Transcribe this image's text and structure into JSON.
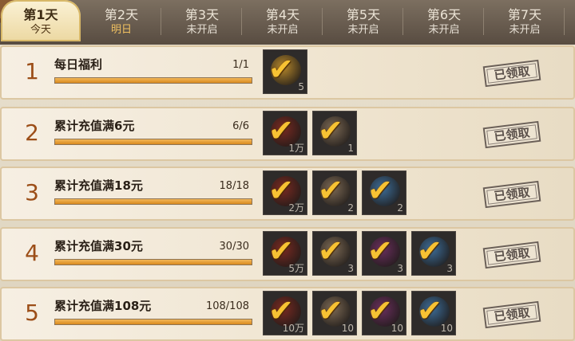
{
  "tabs": [
    {
      "day": "第1天",
      "status": "今天",
      "state": "active"
    },
    {
      "day": "第2天",
      "status": "明日",
      "state": "next"
    },
    {
      "day": "第3天",
      "status": "未开启",
      "state": "locked"
    },
    {
      "day": "第4天",
      "status": "未开启",
      "state": "locked"
    },
    {
      "day": "第5天",
      "status": "未开启",
      "state": "locked"
    },
    {
      "day": "第6天",
      "status": "未开启",
      "state": "locked"
    },
    {
      "day": "第7天",
      "status": "未开启",
      "state": "locked"
    }
  ],
  "tasks": [
    {
      "num": "1",
      "title": "每日福利",
      "progress": "1/1",
      "progress_fraction": 1.0,
      "stamp": "已领取",
      "rewards": [
        {
          "icon": "gold-medal-icon",
          "color": "#b8892c",
          "qty": "5"
        }
      ]
    },
    {
      "num": "2",
      "title": "累计充值满6元",
      "progress": "6/6",
      "progress_fraction": 1.0,
      "stamp": "已领取",
      "rewards": [
        {
          "icon": "red-coin-icon",
          "color": "#7a2a22",
          "qty": "1万"
        },
        {
          "icon": "bronze-item-icon",
          "color": "#7d6a55",
          "qty": "1"
        }
      ]
    },
    {
      "num": "3",
      "title": "累计充值满18元",
      "progress": "18/18",
      "progress_fraction": 1.0,
      "stamp": "已领取",
      "rewards": [
        {
          "icon": "red-coin-icon",
          "color": "#7a2a22",
          "qty": "2万"
        },
        {
          "icon": "bronze-item-icon",
          "color": "#7d6a55",
          "qty": "2"
        },
        {
          "icon": "blue-orb-icon",
          "color": "#3d6e9a",
          "qty": "2"
        }
      ]
    },
    {
      "num": "4",
      "title": "累计充值满30元",
      "progress": "30/30",
      "progress_fraction": 1.0,
      "stamp": "已领取",
      "rewards": [
        {
          "icon": "red-coin-icon",
          "color": "#7a2a22",
          "qty": "5万"
        },
        {
          "icon": "bronze-item-icon",
          "color": "#7d6a55",
          "qty": "3"
        },
        {
          "icon": "purple-item-icon",
          "color": "#6b2f5e",
          "qty": "3"
        },
        {
          "icon": "blue-orb-icon",
          "color": "#3d6e9a",
          "qty": "3"
        }
      ]
    },
    {
      "num": "5",
      "title": "累计充值满108元",
      "progress": "108/108",
      "progress_fraction": 1.0,
      "stamp": "已领取",
      "rewards": [
        {
          "icon": "red-coin-icon",
          "color": "#7a2a22",
          "qty": "10万"
        },
        {
          "icon": "bronze-item-icon",
          "color": "#7d6a55",
          "qty": "10"
        },
        {
          "icon": "purple-item-icon",
          "color": "#6b2f5e",
          "qty": "10"
        },
        {
          "icon": "blue-orb-icon",
          "color": "#3d6e9a",
          "qty": "10"
        }
      ]
    }
  ],
  "colors": {
    "accent": "#f0c060",
    "number": "#9c4e18",
    "check": "#f7c233"
  }
}
